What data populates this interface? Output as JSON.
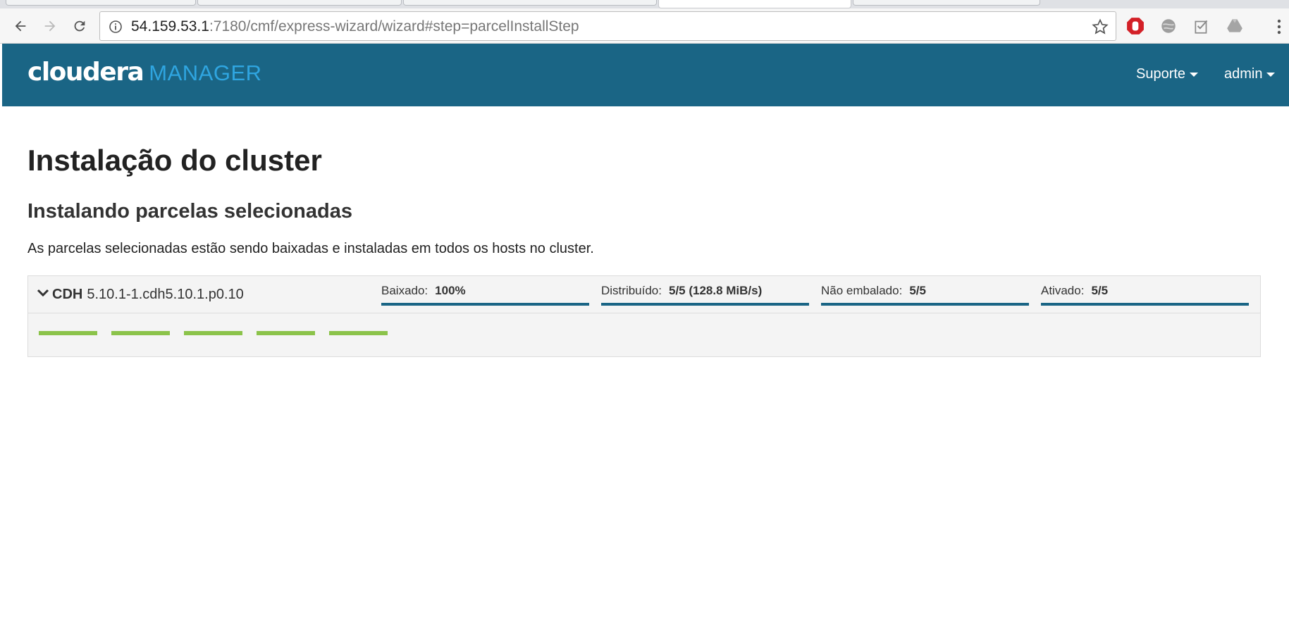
{
  "browser": {
    "url_host": "54.159.53.1",
    "url_rest": ":7180/cmf/express-wizard/wizard#step=parcelInstallStep"
  },
  "header": {
    "brand": "cloudera",
    "product": "MANAGER",
    "menus": [
      {
        "label": "Suporte"
      },
      {
        "label": "admin"
      }
    ],
    "color": "#1a6585",
    "accent": "#2fa5e0"
  },
  "main": {
    "title": "Instalação do cluster",
    "subtitle": "Instalando parcelas selecionadas",
    "description": "As parcelas selecionadas estão sendo baixadas e instaladas em todos os hosts no cluster."
  },
  "parcel": {
    "name": "CDH",
    "version": "5.10.1-1.cdh5.10.1.p0.10",
    "stages": [
      {
        "label": "Baixado:",
        "value": "100%",
        "progress": 1.0
      },
      {
        "label": "Distribuído:",
        "value": "5/5 (128.8 MiB/s)",
        "progress": 1.0
      },
      {
        "label": "Não embalado:",
        "value": "5/5",
        "progress": 1.0
      },
      {
        "label": "Ativado:",
        "value": "5/5",
        "progress": 1.0
      }
    ],
    "hosts_complete": 5,
    "hosts_total": 5,
    "host_bar_color": "#8bc34a"
  }
}
